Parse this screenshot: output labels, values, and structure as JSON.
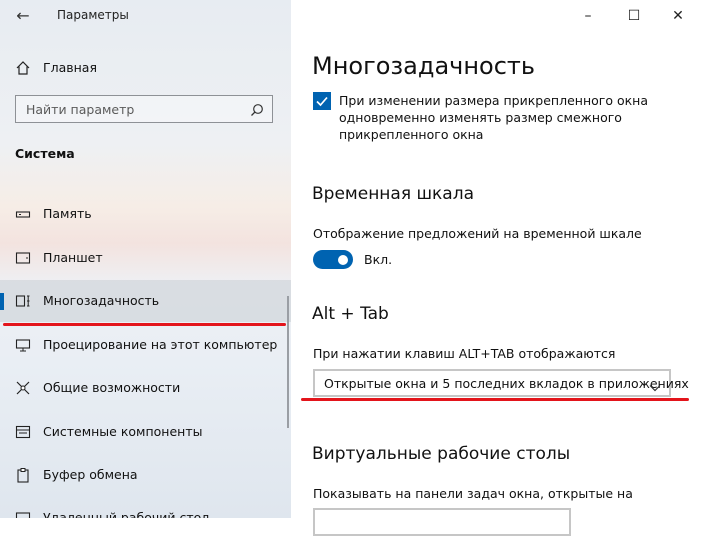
{
  "window": {
    "title": "Параметры",
    "controls": {
      "minimize": "–",
      "maximize": "☐",
      "close": "✕"
    }
  },
  "sidebar": {
    "home_label": "Главная",
    "search_placeholder": "Найти параметр",
    "section_title": "Система",
    "items": [
      {
        "label": "Память",
        "icon": "storage-icon"
      },
      {
        "label": "Планшет",
        "icon": "tablet-icon"
      },
      {
        "label": "Многозадачность",
        "icon": "multitasking-icon",
        "selected": true
      },
      {
        "label": "Проецирование на этот компьютер",
        "icon": "projecting-icon"
      },
      {
        "label": "Общие возможности",
        "icon": "shared-experiences-icon"
      },
      {
        "label": "Системные компоненты",
        "icon": "system-components-icon"
      },
      {
        "label": "Буфер обмена",
        "icon": "clipboard-icon"
      },
      {
        "label": "Удаленный рабочий стол",
        "icon": "remote-desktop-icon"
      }
    ]
  },
  "main": {
    "title": "Многозадачность",
    "snap_checkbox": {
      "checked": true,
      "text": "При изменении размера прикрепленного окна одновременно изменять размер смежного прикрепленного окна"
    },
    "timeline": {
      "heading": "Временная шкала",
      "label": "Отображение предложений на временной шкале",
      "toggle_state": "Вкл."
    },
    "alttab": {
      "heading": "Alt + Tab",
      "label": "При нажатии клавиш ALT+TAB отображаются",
      "selected": "Открытые окна и 5 последних вкладок в приложениях"
    },
    "virtual_desktops": {
      "heading": "Виртуальные рабочие столы",
      "label": "Показывать на панели задач окна, открытые на"
    }
  },
  "colors": {
    "accent": "#0063b1",
    "annotation_red": "#e3141b"
  }
}
